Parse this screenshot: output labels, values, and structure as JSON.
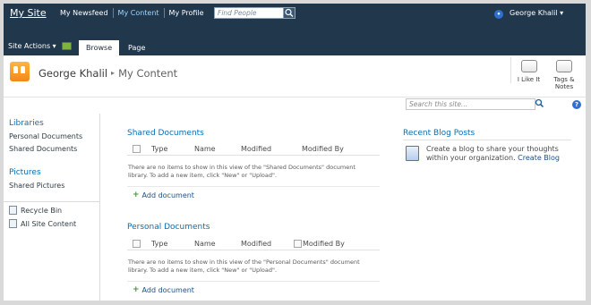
{
  "topbar": {
    "site_link": "My Site",
    "nav": [
      "My Newsfeed",
      "My Content",
      "My Profile"
    ],
    "active_nav": "My Content",
    "find_placeholder": "Find People",
    "user": "George Khalil ▾",
    "site_actions": "Site Actions ▾",
    "tabs": [
      "Browse",
      "Page"
    ]
  },
  "title": {
    "owner": "George Khalil",
    "separator": "▸",
    "current": "My Content"
  },
  "social": {
    "like": "I Like It",
    "tags_line1": "Tags &",
    "tags_line2": "Notes"
  },
  "search": {
    "placeholder": "Search this site...",
    "help": "?"
  },
  "leftnav": {
    "libraries_head": "Libraries",
    "libraries": [
      "Personal Documents",
      "Shared Documents"
    ],
    "pictures_head": "Pictures",
    "pictures": [
      "Shared Pictures"
    ],
    "recycle": "Recycle Bin",
    "all_content": "All Site Content"
  },
  "shared": {
    "title": "Shared Documents",
    "columns": [
      "Type",
      "Name",
      "Modified",
      "Modified By"
    ],
    "empty_line1": "There are no items to show in this view of the \"Shared Documents\" document",
    "empty_line2": "library. To add a new item, click \"New\" or \"Upload\".",
    "add": "Add document"
  },
  "personal": {
    "title": "Personal Documents",
    "columns": [
      "Type",
      "Name",
      "Modified",
      "Modified By"
    ],
    "empty_line1": "There are no items to show in this view of the \"Personal Documents\" document",
    "empty_line2": "library. To add a new item, click \"New\" or \"Upload\".",
    "add": "Add document"
  },
  "blog": {
    "title": "Recent Blog Posts",
    "text": "Create a blog to share your thoughts within your organization.",
    "link": "Create Blog"
  }
}
